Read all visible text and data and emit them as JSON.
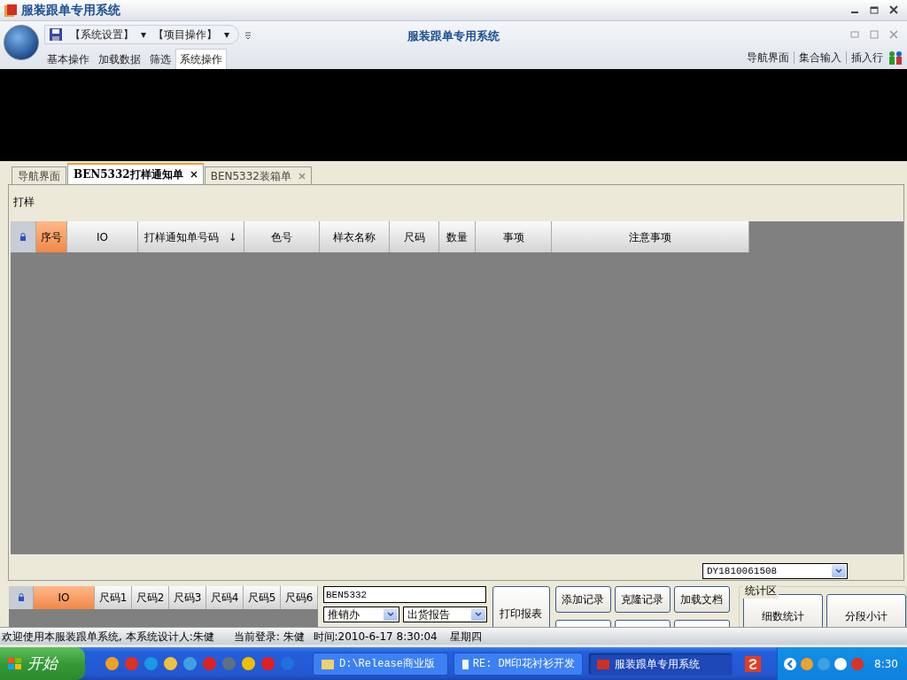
{
  "window": {
    "title": "服装跟单专用系统"
  },
  "quick_access": {
    "menus": [
      {
        "label": "【系统设置】",
        "caret": "▾"
      },
      {
        "label": "【项目操作】",
        "caret": "▾"
      }
    ]
  },
  "ribbon_title": "服装跟单专用系统",
  "ribbon_tabs": [
    {
      "label": "基本操作",
      "selected": false
    },
    {
      "label": "加载数据",
      "selected": false
    },
    {
      "label": "筛选",
      "selected": false
    },
    {
      "label": "系统操作",
      "selected": true
    }
  ],
  "ribbon_links": [
    "导航界面",
    "集合输入",
    "插入行"
  ],
  "doc_tabs": [
    {
      "label": "导航界面",
      "selected": false,
      "closable": false
    },
    {
      "label": "BEN5332打样通知单",
      "selected": true,
      "closable": true
    },
    {
      "label": "BEN5332装箱单",
      "selected": false,
      "closable": true
    }
  ],
  "panel_label": "打样",
  "grid": {
    "columns": [
      {
        "label": "序号",
        "highlighted": true
      },
      {
        "label": "IO",
        "highlighted": false
      },
      {
        "label": "打样通知单号码",
        "highlighted": false,
        "sort_mark": "↓"
      },
      {
        "label": "色号",
        "highlighted": false
      },
      {
        "label": "样衣名称",
        "highlighted": false
      },
      {
        "label": "尺码",
        "highlighted": false
      },
      {
        "label": "数量",
        "highlighted": false
      },
      {
        "label": "事项",
        "highlighted": false
      },
      {
        "label": "注意事项",
        "highlighted": false
      }
    ]
  },
  "order_combo": {
    "value": "DY1810061508"
  },
  "size_grid": {
    "columns": [
      {
        "label": "IO",
        "highlighted": true
      },
      {
        "label": "尺码1",
        "highlighted": false
      },
      {
        "label": "尺码2",
        "highlighted": false
      },
      {
        "label": "尺码3",
        "highlighted": false
      },
      {
        "label": "尺码4",
        "highlighted": false
      },
      {
        "label": "尺码5",
        "highlighted": false
      },
      {
        "label": "尺码6",
        "highlighted": false
      }
    ]
  },
  "style_field": {
    "value": "BEN5332"
  },
  "selects": [
    {
      "value": "推销办"
    },
    {
      "value": "出货报告"
    }
  ],
  "print_button": "打印报表",
  "action_buttons": [
    "添加记录",
    "克隆记录",
    "加载文档"
  ],
  "stats": {
    "title": "统计区",
    "buttons": [
      "细数统计",
      "分段小计"
    ]
  },
  "status_bar": {
    "welcome": "欢迎使用本服装跟单系统, 本系统设计人:朱健",
    "login": "当前登录: 朱健",
    "time": "时间:2010-6-17 8:30:04",
    "weekday": "星期四"
  },
  "taskbar": {
    "start": "开始",
    "tasks": [
      {
        "label": "D:\\Release商业版",
        "selected": false
      },
      {
        "label": "RE: DM印花衬衫开发",
        "selected": false
      },
      {
        "label": "服装跟单专用系统",
        "selected": true
      }
    ],
    "clock": "8:30"
  }
}
